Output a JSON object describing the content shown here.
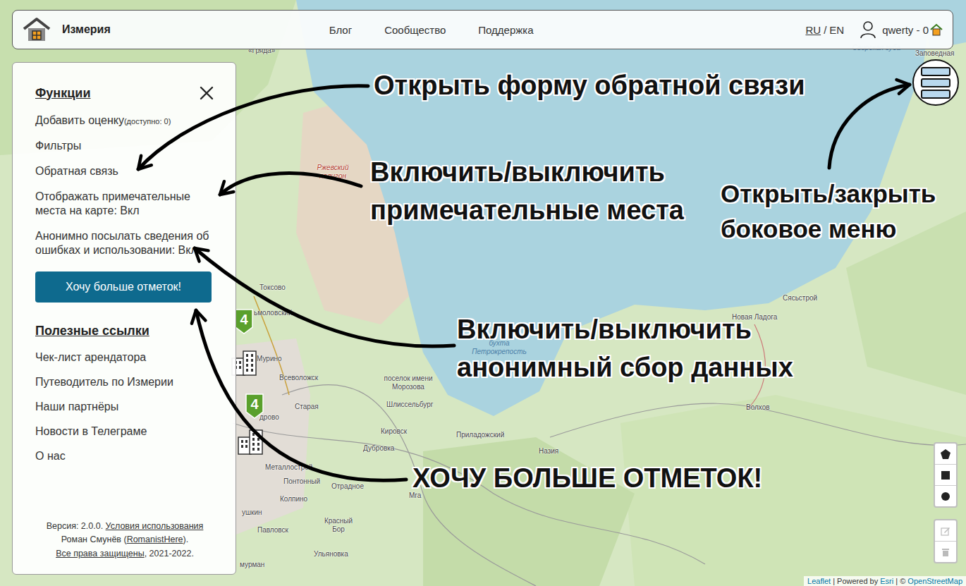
{
  "header": {
    "logo": "Измерия",
    "nav": [
      "Блог",
      "Сообщество",
      "Поддержка"
    ],
    "languages": [
      {
        "label": "RU",
        "selected": true
      },
      {
        "label": "EN",
        "selected": false
      }
    ],
    "language_separator": "/",
    "user": "qwerty - 0"
  },
  "sidebar": {
    "functions_title": "Функции",
    "functions": [
      {
        "label": "Добавить оценку",
        "note": "(доступно: 0)"
      },
      {
        "label": "Фильтры",
        "note": ""
      },
      {
        "label": "Обратная связь",
        "note": ""
      },
      {
        "label": "Отображать примечательные места на карте: Вкл",
        "note": ""
      },
      {
        "label": "Анонимно посылать сведения об ошибках и использовании: Вкл",
        "note": ""
      }
    ],
    "cta": "Хочу больше отметок!",
    "links_title": "Полезные ссылки",
    "links": [
      "Чек-лист арендатора",
      "Путеводитель по Измерии",
      "Наши партнёры",
      "Новости в Телеграме",
      "О нас"
    ],
    "footer": [
      [
        {
          "text": "Версия: 2.0.0. ",
          "link": false
        },
        {
          "text": "Условия использования",
          "link": true
        }
      ],
      [
        {
          "text": "Роман Смунёв (",
          "link": false
        },
        {
          "text": "RomanistHere",
          "link": true
        },
        {
          "text": ").",
          "link": false
        }
      ],
      [
        {
          "text": "Все права защищены",
          "link": true
        },
        {
          "text": ", 2021-2022.",
          "link": false
        }
      ]
    ]
  },
  "map": {
    "labels": [
      {
        "text": "«Гряда»",
        "kind": "town"
      },
      {
        "text": "Ржевский полигон",
        "kind": "zone"
      },
      {
        "text": "Токсово",
        "kind": "town"
      },
      {
        "text": "ьмоловский",
        "kind": "town"
      },
      {
        "text": "Мурино",
        "kind": "town"
      },
      {
        "text": "Всеволожск",
        "kind": "town"
      },
      {
        "text": "поселок имени Морозова",
        "kind": "town"
      },
      {
        "text": "Шлиссельбург",
        "kind": "town"
      },
      {
        "text": "Старая",
        "kind": "town"
      },
      {
        "text": "дрово",
        "kind": "town"
      },
      {
        "text": "Кировск",
        "kind": "town"
      },
      {
        "text": "Дубровка",
        "kind": "town"
      },
      {
        "text": "Приладожский",
        "kind": "town"
      },
      {
        "text": "Назия",
        "kind": "town"
      },
      {
        "text": "Металлострой",
        "kind": "town"
      },
      {
        "text": "Понтонный",
        "kind": "town"
      },
      {
        "text": "Отрадное",
        "kind": "town"
      },
      {
        "text": "Мга",
        "kind": "town"
      },
      {
        "text": "Колпино",
        "kind": "town"
      },
      {
        "text": "ушкин",
        "kind": "town"
      },
      {
        "text": "Павловск",
        "kind": "town"
      },
      {
        "text": "Красный Бор",
        "kind": "town"
      },
      {
        "text": "Ульяновка",
        "kind": "town"
      },
      {
        "text": "мурман",
        "kind": "town"
      },
      {
        "text": "Новая Ладога",
        "kind": "town"
      },
      {
        "text": "Сясьстрой",
        "kind": "town"
      },
      {
        "text": "Волхов",
        "kind": "town"
      },
      {
        "text": "бухта Петрокрепость",
        "kind": "water"
      },
      {
        "text": "губа",
        "kind": "water"
      },
      {
        "text": "Свирская губа",
        "kind": "water"
      },
      {
        "text": "Заповедная",
        "kind": "town"
      }
    ],
    "markers": [
      {
        "count": "4"
      },
      {
        "count": "4"
      }
    ],
    "attribution": [
      {
        "text": "Leaflet",
        "link": true
      },
      {
        "text": " | Powered by ",
        "link": false
      },
      {
        "text": "Esri",
        "link": true
      },
      {
        "text": " | © ",
        "link": false
      },
      {
        "text": "OpenStreetMap",
        "link": true
      }
    ]
  },
  "annotations": [
    {
      "lines": [
        "Открыть форму обратной связи"
      ]
    },
    {
      "lines": [
        "Включить/выключить",
        "примечательные места"
      ]
    },
    {
      "lines": [
        "Открыть/закрыть",
        "боковое меню"
      ]
    },
    {
      "lines": [
        "Включить/выключить",
        "анонимный сбор данных"
      ]
    },
    {
      "lines": [
        "ХОЧУ БОЛЬШЕ ОТМЕТОК!"
      ]
    }
  ]
}
